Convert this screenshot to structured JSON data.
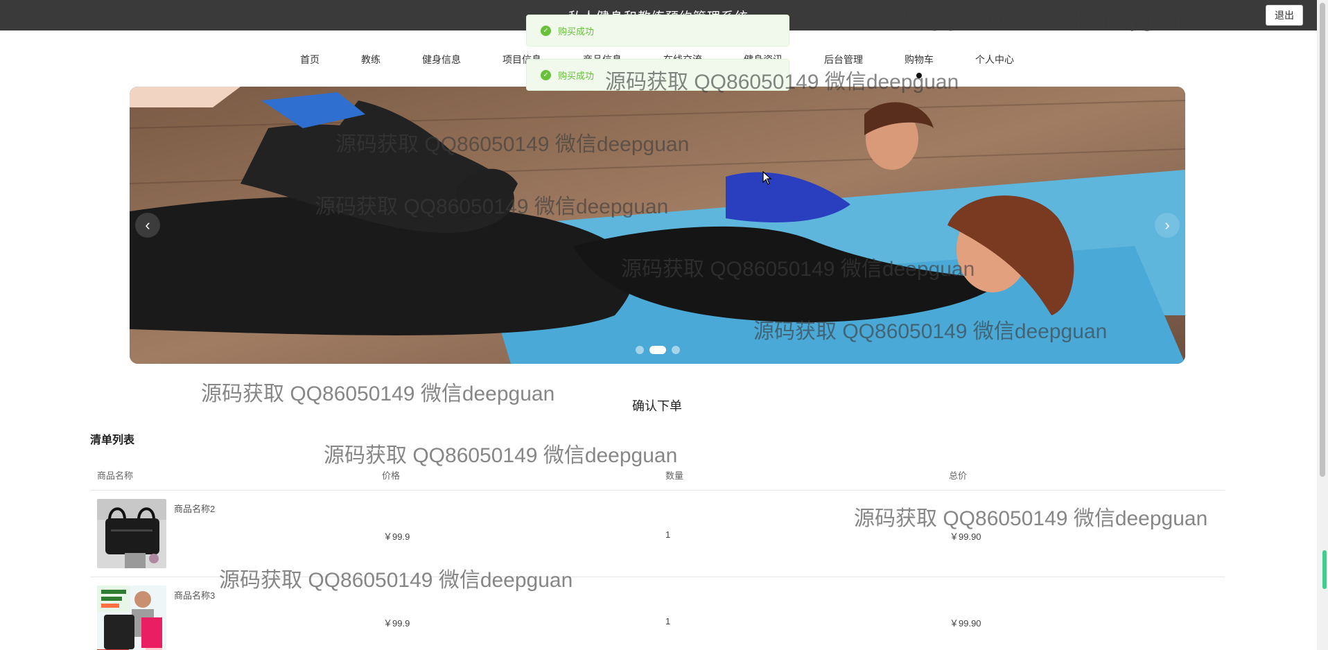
{
  "header": {
    "site_title": "私人健身和教练预约管理系统",
    "logout_label": "退出"
  },
  "nav": {
    "items": [
      "首页",
      "教练",
      "健身信息",
      "项目信息",
      "商品信息",
      "在线交流",
      "健身资讯",
      "后台管理",
      "购物车",
      "个人中心"
    ]
  },
  "notifications": [
    {
      "message": "购买成功"
    },
    {
      "message": "购买成功"
    }
  ],
  "banner": {
    "prev_label": "‹",
    "next_label": "›",
    "slide_count": 3,
    "active_slide": 2
  },
  "main": {
    "heading": "确认下单",
    "list_title": "清单列表",
    "columns": [
      "商品名称",
      "价格",
      "数量",
      "总价"
    ],
    "rows": [
      {
        "name": "商品名称2",
        "price": "￥99.9",
        "qty": "1",
        "total": "￥99.90"
      },
      {
        "name": "商品名称3",
        "price": "￥99.9",
        "qty": "1",
        "total": "￥99.90"
      }
    ]
  },
  "watermark_text": "源码获取 QQ86050149 微信deepguan",
  "colors": {
    "topbar": "#3a3a3a",
    "success": "#67c23a",
    "toast_bg": "#f0f9eb"
  }
}
